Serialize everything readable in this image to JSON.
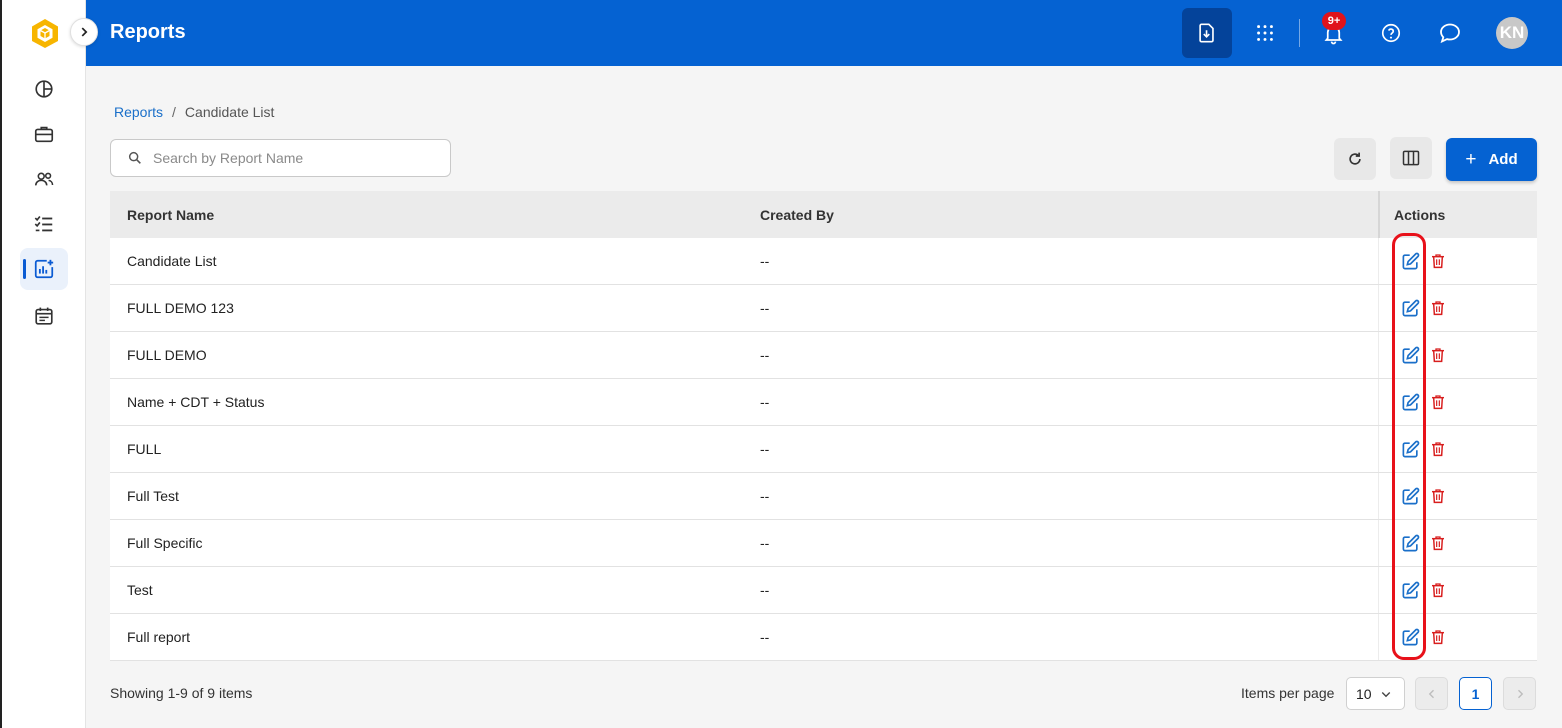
{
  "app": {
    "title": "Reports"
  },
  "topbar": {
    "notifications_count": "9+",
    "avatar_initials": "KN"
  },
  "sidebar": {
    "items": [
      {
        "name": "dashboard",
        "icon": "pie-chart-icon"
      },
      {
        "name": "jobs",
        "icon": "briefcase-icon"
      },
      {
        "name": "candidates",
        "icon": "people-icon"
      },
      {
        "name": "tasks",
        "icon": "checklist-icon"
      },
      {
        "name": "reports",
        "icon": "report-chart-icon",
        "active": true
      },
      {
        "name": "calendar",
        "icon": "calendar-icon"
      }
    ]
  },
  "breadcrumb": {
    "root": "Reports",
    "separator": "/",
    "current": "Candidate List"
  },
  "search": {
    "placeholder": "Search by Report Name",
    "value": ""
  },
  "toolbar": {
    "add_label": "Add",
    "add_symbol": "+"
  },
  "table": {
    "headers": {
      "name": "Report Name",
      "created_by": "Created By",
      "actions": "Actions"
    },
    "rows": [
      {
        "name": "Candidate List",
        "created_by": "--"
      },
      {
        "name": "FULL DEMO 123",
        "created_by": "--"
      },
      {
        "name": "FULL DEMO",
        "created_by": "--"
      },
      {
        "name": "Name + CDT + Status",
        "created_by": "--"
      },
      {
        "name": "FULL",
        "created_by": "--"
      },
      {
        "name": "Full Test",
        "created_by": "--"
      },
      {
        "name": "Full Specific",
        "created_by": "--"
      },
      {
        "name": "Test",
        "created_by": "--"
      },
      {
        "name": "Full report",
        "created_by": "--"
      }
    ]
  },
  "footer": {
    "showing": "Showing 1-9 of 9 items",
    "items_per_page_label": "Items per page",
    "items_per_page_value": "10",
    "current_page": "1"
  },
  "colors": {
    "brand": "#0562d2",
    "edit": "#1a6fc9",
    "delete": "#d81e1e",
    "highlight": "#e8111a"
  }
}
